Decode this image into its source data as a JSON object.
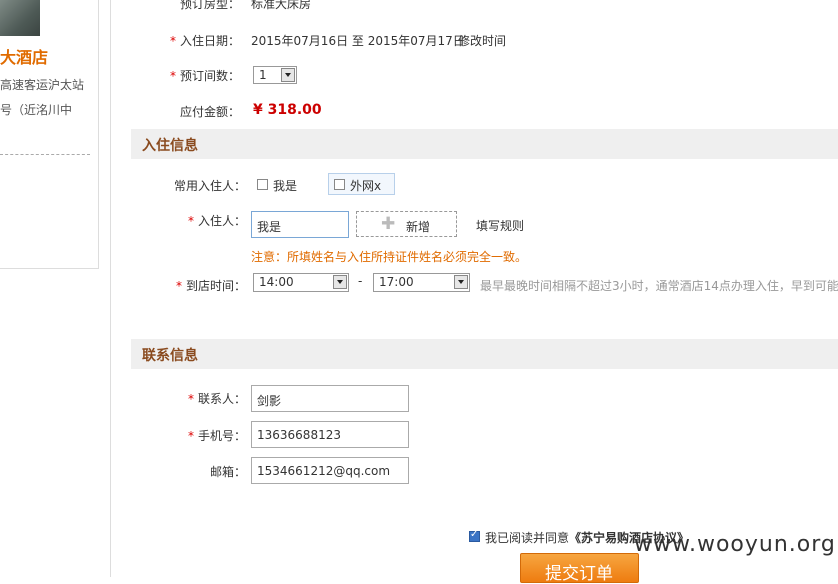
{
  "hotel": {
    "name": "大酒店",
    "address_line1": "高速客运沪太站",
    "address_line2": "号（近洺川中"
  },
  "order": {
    "room_type_label": "预订房型：",
    "room_type_value": "标准大床房",
    "checkin_label": "入住日期：",
    "checkin_value": "2015年07月16日 至 2015年07月17日",
    "modify_time_link": "修改时间",
    "room_count_label": "预订间数：",
    "room_count_value": "1",
    "amount_label": "应付金额：",
    "amount_value": "¥ 318.00"
  },
  "guest_section": {
    "title": "入住信息",
    "frequent_label": "常用入住人：",
    "frequent_options": [
      {
        "label": "我是",
        "checked": false
      },
      {
        "label": "外网x",
        "checked": false
      }
    ],
    "guest_label": "入住人：",
    "guest_value": "我是",
    "add_label": "新增",
    "rules_link": "填写规则",
    "notice": "注意：所填姓名与入住所持证件姓名必须完全一致。",
    "arrival_label": "到店时间：",
    "arrival_from": "14:00",
    "arrival_separator": "-",
    "arrival_to": "17:00",
    "arrival_hint": "最早最晚时间相隔不超过3小时，通常酒店14点办理入住，早到可能"
  },
  "contact_section": {
    "title": "联系信息",
    "contact_label": "联系人：",
    "contact_value": "剑影",
    "phone_label": "手机号：",
    "phone_value": "13636688123",
    "email_label": "邮箱：",
    "email_value": "1534661212@qq.com"
  },
  "agreement": {
    "checked": true,
    "text": "我已阅读并同意",
    "link": "《苏宁易购酒店协议》"
  },
  "submit_label": "提交订单",
  "watermark": "www.wooyun.org",
  "colors": {
    "accent": "#e06b00",
    "price": "#cc0000",
    "notice": "#e06b00",
    "section_title": "#8a4b1f"
  }
}
